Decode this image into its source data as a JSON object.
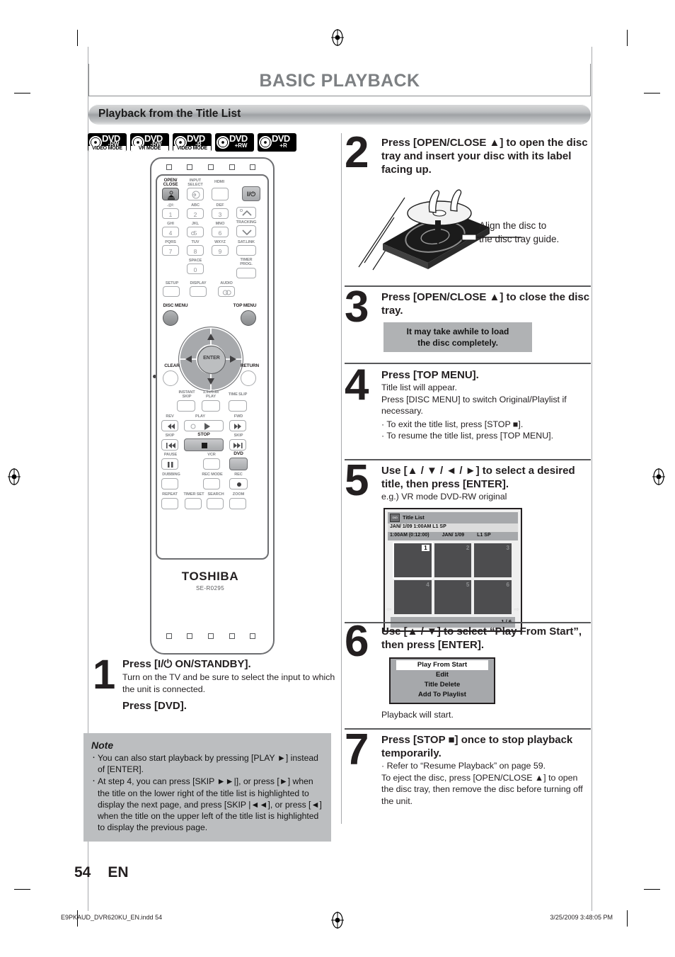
{
  "header": {
    "chapter_title": "BASIC PLAYBACK",
    "section_title": "Playback from the Title List"
  },
  "badges": [
    {
      "dvd": "DVD",
      "fmt": "-RW",
      "mode": "VIDEO MODE"
    },
    {
      "dvd": "DVD",
      "fmt": "-RW",
      "mode": "VR MODE"
    },
    {
      "dvd": "DVD",
      "fmt": "-R",
      "mode": "VIDEO MODE"
    },
    {
      "dvd": "DVD",
      "fmt": "+RW",
      "mode": ""
    },
    {
      "dvd": "DVD",
      "fmt": "+R",
      "mode": ""
    }
  ],
  "remote": {
    "brand": "TOSHIBA",
    "model": "SE-R0295",
    "labels": {
      "open_close": "OPEN/\nCLOSE",
      "input_select": "INPUT\nSELECT",
      "hdmi": "HDMI",
      "power": "I/⏻",
      "k1_alpha": ".@/:",
      "k1": "1",
      "k2_alpha": "ABC",
      "k2": "2",
      "k3_alpha": "DEF",
      "k3": "3",
      "k4_alpha": "GHI",
      "k4": "4",
      "k5_alpha": "JKL",
      "k5": "5",
      "k6_alpha": "MNO",
      "k6": "6",
      "k7_alpha": "PQRS",
      "k7": "7",
      "k8_alpha": "TUV",
      "k8": "8",
      "k9_alpha": "WXYZ",
      "k9": "9",
      "k0_alpha": "SPACE",
      "k0": "0",
      "tracking": "TRACKING",
      "sat_link": "SAT.LINK",
      "timer_prog": "TIMER\nPROG.",
      "setup": "SETUP",
      "display": "DISPLAY",
      "audio": "AUDIO",
      "disc_menu": "DISC MENU",
      "top_menu": "TOP MENU",
      "enter": "ENTER",
      "clear": "CLEAR",
      "return": "RETURN",
      "instant_skip": "INSTANT\nSKIP",
      "speed_play": "1.3x/0.8x\nPLAY",
      "time_slip": "TIME SLIP",
      "rev": "REV",
      "play": "PLAY",
      "fwd": "FWD",
      "skip_left": "SKIP",
      "stop": "STOP",
      "skip_right": "SKIP",
      "pause": "PAUSE",
      "vcr": "VCR",
      "dvd": "DVD",
      "dubbing": "DUBBING",
      "rec_mode": "REC MODE",
      "rec": "REC",
      "repeat": "REPEAT",
      "timer_set": "TIMER SET",
      "search": "SEARCH",
      "zoom": "ZOOM"
    }
  },
  "steps": {
    "s1": {
      "num": "1",
      "head": "Press [I/⏻ ON/STANDBY].",
      "body": "Turn on the TV and be sure to select the input to which the unit is connected.",
      "head2": "Press [DVD]."
    },
    "s2": {
      "num": "2",
      "head": "Press [OPEN/CLOSE ▲] to open the disc tray and insert your disc with its label facing up.",
      "caption": "Align the disc to\nthe disc tray guide."
    },
    "s3": {
      "num": "3",
      "head": "Press [OPEN/CLOSE ▲] to close the disc tray.",
      "note": "It may take awhile to load\nthe disc completely."
    },
    "s4": {
      "num": "4",
      "head": "Press [TOP MENU].",
      "body1": "Title list will appear.",
      "body2": "Press [DISC MENU] to switch Original/Playlist if necessary.",
      "bullet1": "· To exit the title list, press [STOP ■].",
      "bullet2": "· To resume the title list, press [TOP MENU]."
    },
    "s5": {
      "num": "5",
      "head": "Use [▲ / ▼ / ◄ / ►] to select a desired title, then press [ENTER].",
      "body": "e.g.) VR mode DVD-RW original"
    },
    "s6": {
      "num": "6",
      "head": "Use [▲ / ▼] to select “Play From Start”, then press [ENTER].",
      "body": "Playback will start."
    },
    "s7": {
      "num": "7",
      "head": "Press [STOP ■] once to stop playback temporarily.",
      "bullet": "· Refer to “Resume Playback” on page 59.",
      "body": "To eject the disc, press [OPEN/CLOSE ▲] to open the disc tray, then remove the disc before turning off the unit."
    }
  },
  "title_list_osd": {
    "window_title": "Title List",
    "row1": "JAN/ 1/09 1:00AM  L1  SP",
    "row2_time": "1:00AM (0:12:00)",
    "row2_date": "JAN/  1/09",
    "row2_mode": "L1  SP",
    "thumbs": [
      "1",
      "2",
      "3",
      "4",
      "5",
      "6"
    ],
    "selected_index": 0,
    "page_indicator": "1 / 6",
    "arrow_left": "⇦",
    "arrow_right": "⇨"
  },
  "menu_osd": {
    "items": [
      "Play From Start",
      "Edit",
      "Title Delete",
      "Add To Playlist"
    ],
    "selected_index": 0
  },
  "note": {
    "heading": "Note",
    "items": [
      "You can also start playback by pressing [PLAY ►] instead of [ENTER].",
      "At step 4, you can press [SKIP ►►|], or press [►] when the title on the lower right of the title list is highlighted to display the next page, and press [SKIP |◄◄], or press [◄] when the title on the upper left of the title list is highlighted to display the previous page."
    ]
  },
  "page": {
    "number": "54",
    "lang": "EN"
  },
  "footer": {
    "file": "E9PKAUD_DVR620KU_EN.indd   54",
    "timestamp": "3/25/2009   3:48:05 PM"
  },
  "colors": {
    "title_grey": "#7d8083",
    "bar_grey": "#b0b2b4",
    "note_bg": "#bcbec0"
  }
}
